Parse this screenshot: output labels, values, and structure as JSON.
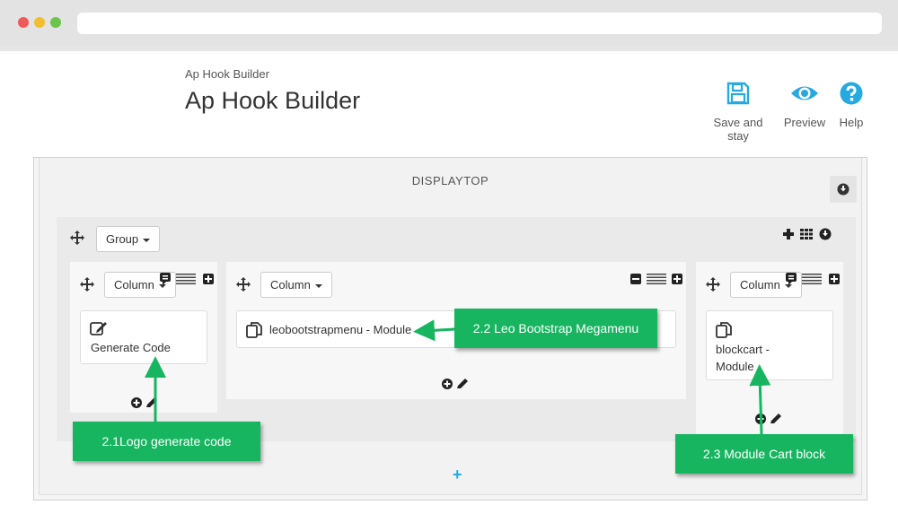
{
  "header": {
    "breadcrumb": "Ap Hook Builder",
    "title": "Ap Hook Builder",
    "toolbar": [
      {
        "label": "Save and stay",
        "icon": "save-icon"
      },
      {
        "label": "Preview",
        "icon": "eye-icon"
      },
      {
        "label": "Help",
        "icon": "help-icon"
      }
    ]
  },
  "hook": {
    "title": "DISPLAYTOP",
    "group": {
      "label": "Group",
      "columns": [
        {
          "label": "Column",
          "module": {
            "icon": "code-edit-icon",
            "label": "Generate Code"
          }
        },
        {
          "label": "Column",
          "module": {
            "icon": "copy-icon",
            "label": "leobootstrapmenu - Module"
          }
        },
        {
          "label": "Column",
          "module": {
            "icon": "copy-icon",
            "label": "blockcart -\nModule"
          }
        }
      ]
    },
    "add_label": "+"
  },
  "callouts": [
    {
      "text": "2.1Logo generate code"
    },
    {
      "text": "2.2 Leo Bootstrap Megamenu"
    },
    {
      "text": "2.3 Module Cart block"
    }
  ],
  "colors": {
    "accent": "#25a9e1",
    "callout": "#17b55f",
    "icon_blue": "#25a9e1"
  }
}
